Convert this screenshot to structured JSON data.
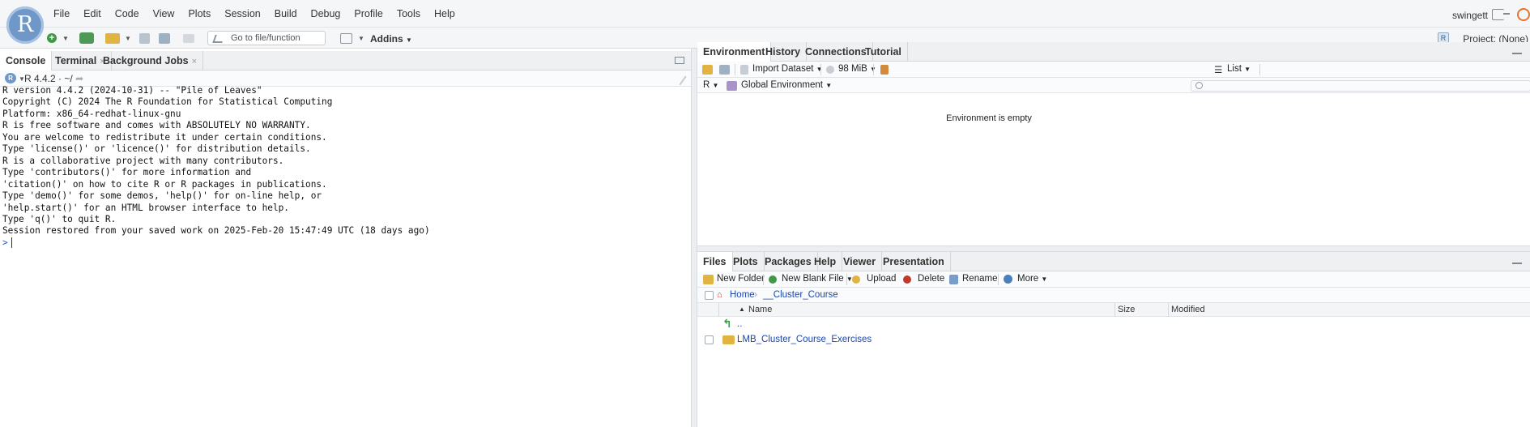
{
  "menubar": {
    "logo": "R",
    "items": [
      "File",
      "Edit",
      "Code",
      "View",
      "Plots",
      "Session",
      "Build",
      "Debug",
      "Profile",
      "Tools",
      "Help"
    ],
    "user": "swingett"
  },
  "toolbar": {
    "goto_placeholder": "Go to file/function",
    "addins_label": "Addins",
    "project_label": "Project: (None)"
  },
  "console": {
    "tabs": [
      {
        "label": "Console",
        "active": true
      },
      {
        "label": "Terminal",
        "closable": true
      },
      {
        "label": "Background Jobs",
        "closable": true
      }
    ],
    "r_version_label": "R 4.4.2",
    "working_dir": "~/",
    "lines": [
      "",
      "R version 4.4.2 (2024-10-31) -- \"Pile of Leaves\"",
      "Copyright (C) 2024 The R Foundation for Statistical Computing",
      "Platform: x86_64-redhat-linux-gnu",
      "",
      "R is free software and comes with ABSOLUTELY NO WARRANTY.",
      "You are welcome to redistribute it under certain conditions.",
      "Type 'license()' or 'licence()' for distribution details.",
      "",
      "R is a collaborative project with many contributors.",
      "Type 'contributors()' for more information and",
      "'citation()' on how to cite R or R packages in publications.",
      "",
      "Type 'demo()' for some demos, 'help()' for on-line help, or",
      "'help.start()' for an HTML browser interface to help.",
      "Type 'q()' to quit R.",
      "",
      "Session restored from your saved work on 2025-Feb-20 15:47:49 UTC (18 days ago)"
    ],
    "prompt": ">"
  },
  "environment": {
    "tabs": [
      {
        "label": "Environment",
        "active": true
      },
      {
        "label": "History"
      },
      {
        "label": "Connections"
      },
      {
        "label": "Tutorial"
      }
    ],
    "import_dataset_label": "Import Dataset",
    "memory_label": "98 MiB",
    "view_mode_label": "List",
    "language_label": "R",
    "scope_label": "Global Environment",
    "empty_message": "Environment is empty"
  },
  "files": {
    "tabs": [
      {
        "label": "Files",
        "active": true
      },
      {
        "label": "Plots"
      },
      {
        "label": "Packages"
      },
      {
        "label": "Help"
      },
      {
        "label": "Viewer"
      },
      {
        "label": "Presentation"
      }
    ],
    "toolbar": {
      "new_folder": "New Folder",
      "new_blank_file": "New Blank File",
      "upload": "Upload",
      "delete": "Delete",
      "rename": "Rename",
      "more": "More"
    },
    "breadcrumb": {
      "home": "Home",
      "separator": "›",
      "folder": "__Cluster_Course"
    },
    "columns": {
      "name": "Name",
      "size": "Size",
      "modified": "Modified"
    },
    "rows": [
      {
        "name": "..",
        "type": "up"
      },
      {
        "name": "LMB_Cluster_Course_Exercises",
        "type": "folder"
      }
    ]
  },
  "colors": {
    "accent_blue": "#6f97c8",
    "link_blue": "#1c46b0",
    "prompt_blue": "#1d62c9",
    "folder_yellow": "#e1b441",
    "green_icon": "#3e9a47"
  }
}
